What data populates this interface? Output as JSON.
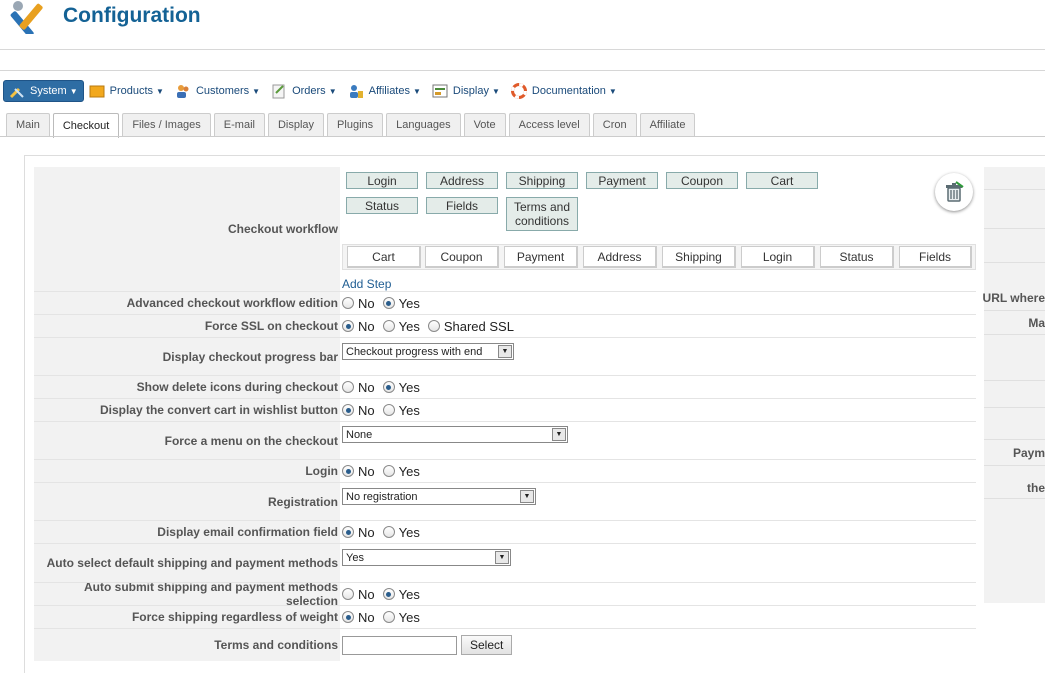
{
  "header": {
    "title": "Configuration"
  },
  "menu": [
    {
      "label": "System",
      "icon": "tools-icon",
      "active": true
    },
    {
      "label": "Products",
      "icon": "box-icon"
    },
    {
      "label": "Customers",
      "icon": "users-icon"
    },
    {
      "label": "Orders",
      "icon": "order-icon"
    },
    {
      "label": "Affiliates",
      "icon": "affiliate-icon"
    },
    {
      "label": "Display",
      "icon": "display-icon"
    },
    {
      "label": "Documentation",
      "icon": "lifebuoy-icon"
    }
  ],
  "tabs": [
    "Main",
    "Checkout",
    "Files / Images",
    "E-mail",
    "Display",
    "Plugins",
    "Languages",
    "Vote",
    "Access level",
    "Cron",
    "Affiliate"
  ],
  "active_tab": "Checkout",
  "workflow": {
    "label": "Checkout workflow",
    "available": [
      "Login",
      "Address",
      "Shipping",
      "Payment",
      "Coupon",
      "Cart",
      "Status",
      "Fields",
      "Terms and conditions"
    ],
    "steps": [
      "Cart",
      "Coupon",
      "Payment",
      "Address",
      "Shipping",
      "Login",
      "Status",
      "Fields"
    ],
    "add_step": "Add Step"
  },
  "fields": {
    "advanced_workflow": {
      "label": "Advanced checkout workflow edition",
      "options": [
        "No",
        "Yes"
      ],
      "selected": "Yes"
    },
    "force_ssl": {
      "label": "Force SSL on checkout",
      "options": [
        "No",
        "Yes",
        "Shared SSL"
      ],
      "selected": "No"
    },
    "progress_bar": {
      "label": "Display checkout progress bar",
      "value": "Checkout progress with end"
    },
    "delete_icons": {
      "label": "Show delete icons during checkout",
      "options": [
        "No",
        "Yes"
      ],
      "selected": "Yes"
    },
    "convert_cart": {
      "label": "Display the convert cart in wishlist button",
      "options": [
        "No",
        "Yes"
      ],
      "selected": "No"
    },
    "force_menu": {
      "label": "Force a menu on the checkout",
      "value": "None"
    },
    "login": {
      "label": "Login",
      "options": [
        "No",
        "Yes"
      ],
      "selected": "No"
    },
    "registration": {
      "label": "Registration",
      "value": "No registration"
    },
    "email_confirm": {
      "label": "Display email confirmation field",
      "options": [
        "No",
        "Yes"
      ],
      "selected": "No"
    },
    "auto_select": {
      "label": "Auto select default shipping and payment methods",
      "value": "Yes"
    },
    "auto_submit": {
      "label": "Auto submit shipping and payment methods selection",
      "options": [
        "No",
        "Yes"
      ],
      "selected": "Yes"
    },
    "force_shipping": {
      "label": "Force shipping regardless of weight",
      "options": [
        "No",
        "Yes"
      ],
      "selected": "No"
    },
    "terms": {
      "label": "Terms and conditions",
      "value": "",
      "button": "Select"
    }
  },
  "right_panel": [
    "URL where",
    "Ma",
    "Paym",
    "the"
  ]
}
